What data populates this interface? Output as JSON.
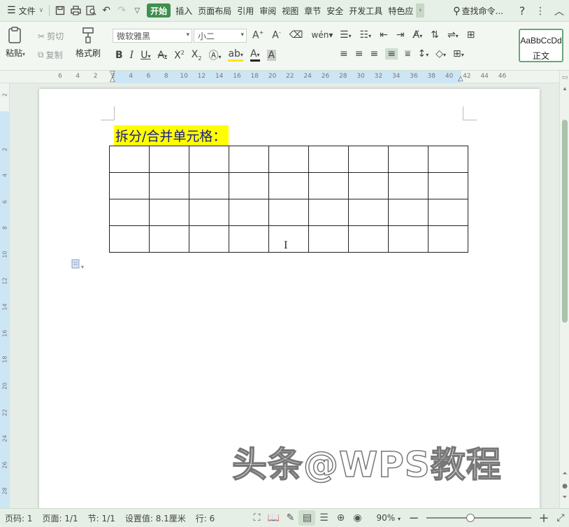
{
  "menubar": {
    "file_label": "文件",
    "tabs": [
      {
        "label": "开始",
        "active": true
      },
      {
        "label": "插入"
      },
      {
        "label": "页面布局"
      },
      {
        "label": "引用"
      },
      {
        "label": "审阅"
      },
      {
        "label": "视图"
      },
      {
        "label": "章节"
      },
      {
        "label": "安全"
      },
      {
        "label": "开发工具"
      },
      {
        "label": "特色应"
      }
    ],
    "search_label": "查找命令...",
    "help_icon": "?",
    "more_icon": "⋮",
    "collapse_icon": "︿"
  },
  "ribbon": {
    "paste_label": "粘贴",
    "cut_label": "剪切",
    "copy_label": "复制",
    "format_painter_label": "格式刷",
    "font_name": "微软雅黑",
    "font_size": "小二",
    "style_sample": "AaBbCcDd",
    "style_name": "正文"
  },
  "ruler": {
    "h_ticks": [
      "6",
      "4",
      "2",
      "2",
      "4",
      "6",
      "8",
      "10",
      "12",
      "14",
      "16",
      "18",
      "20",
      "22",
      "24",
      "26",
      "28",
      "30",
      "32",
      "34",
      "36",
      "38",
      "40",
      "42",
      "44",
      "46"
    ],
    "v_ticks": [
      "2",
      "2",
      "4",
      "6",
      "8",
      "10",
      "12",
      "14",
      "16",
      "18",
      "20",
      "22",
      "24",
      "26",
      "28"
    ]
  },
  "document": {
    "heading": "拆分/合并单元格：",
    "table": {
      "rows": 4,
      "cols": 9
    },
    "watermark": "头条@WPS教程"
  },
  "statusbar": {
    "page_no": "页码: 1",
    "pages": "页面: 1/1",
    "section": "节: 1/1",
    "setting": "设置值: 8.1厘米",
    "line": "行: 6",
    "zoom": "90%",
    "zoom_fraction": 0.42
  },
  "colors": {
    "accent": "#3f8f4f",
    "heading_highlight": "#ffff00",
    "heading_text": "#1a1a8c"
  }
}
